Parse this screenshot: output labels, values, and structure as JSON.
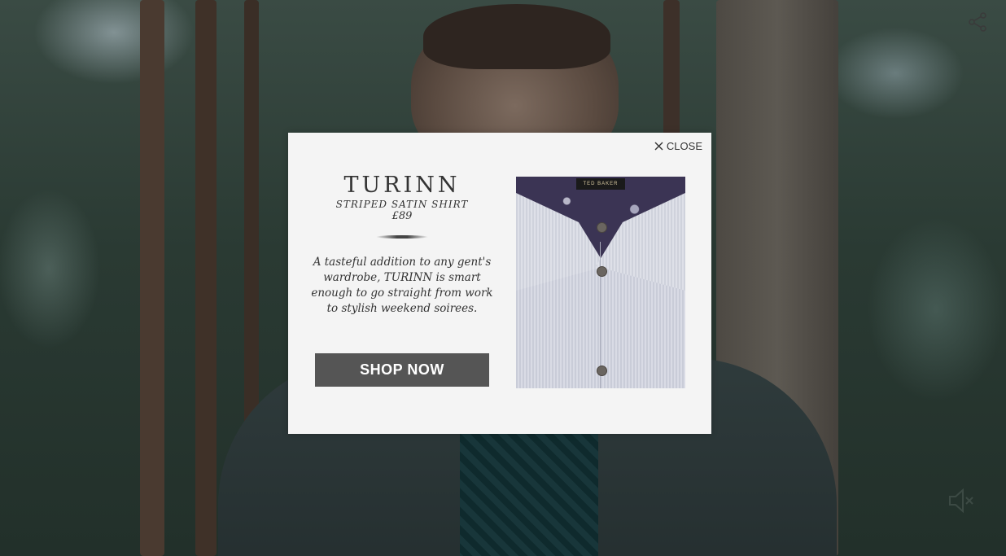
{
  "popup": {
    "close_label": "CLOSE",
    "product": {
      "name": "TURINN",
      "subtitle": "STRIPED SATIN SHIRT",
      "price": "£89",
      "description": "A tasteful addition to any gent's wardrobe, TURINN is smart enough to go straight from work to stylish weekend soirees.",
      "cta_label": "SHOP NOW",
      "image_label": "TED BAKER"
    }
  },
  "controls": {
    "share_icon": "share-icon",
    "mute_icon": "speaker-muted-icon"
  },
  "colors": {
    "modal_bg": "#f4f4f4",
    "button_bg": "#555555",
    "text": "#333333"
  }
}
